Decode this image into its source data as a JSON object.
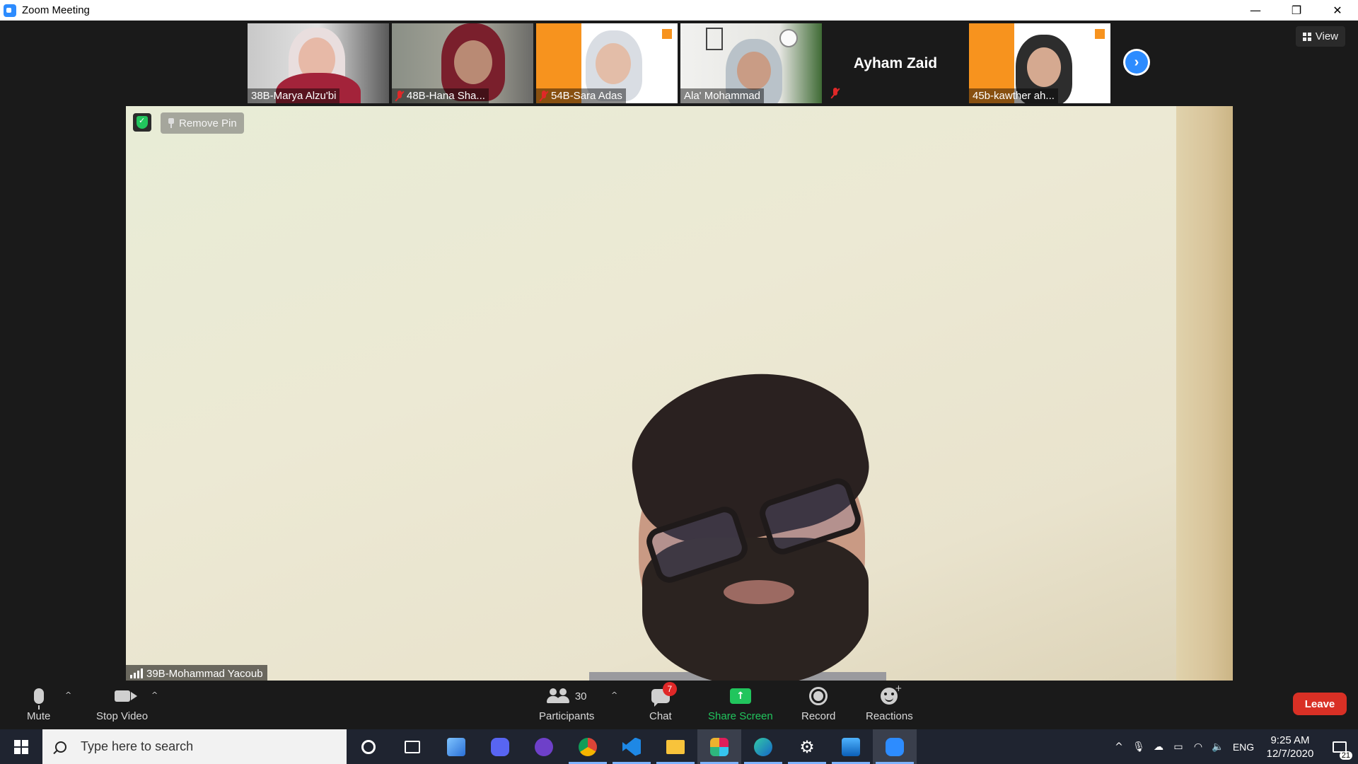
{
  "window": {
    "title": "Zoom Meeting",
    "controls": {
      "minimize": "—",
      "restore": "❐",
      "close": "✕"
    }
  },
  "thumbnails": [
    {
      "name": "38B-Marya Alzu'bi",
      "muted": false
    },
    {
      "name": "48B-Hana Sha...",
      "muted": true
    },
    {
      "name": "54B-Sara Adas",
      "muted": true
    },
    {
      "name": "Ala' Mohammad",
      "muted": false
    },
    {
      "name": "Ayham Zaid",
      "muted": true,
      "video": false
    },
    {
      "name": "45b-kawther ah...",
      "muted": false
    }
  ],
  "view_button": {
    "label": "View"
  },
  "main_video": {
    "remove_pin_label": "Remove Pin",
    "speaker_name": "39B-Mohammad Yacoub"
  },
  "toolbar": {
    "mute_label": "Mute",
    "stop_video_label": "Stop Video",
    "participants_label": "Participants",
    "participants_count": "30",
    "chat_label": "Chat",
    "chat_badge": "7",
    "share_screen_label": "Share Screen",
    "record_label": "Record",
    "reactions_label": "Reactions",
    "leave_label": "Leave"
  },
  "taskbar": {
    "search_placeholder": "Type here to search",
    "language": "ENG",
    "time": "9:25 AM",
    "date": "12/7/2020",
    "notification_count": "21",
    "apps": [
      "cortana-icon",
      "task-view-icon",
      "azure-storage-icon",
      "discord-icon",
      "github-desktop-icon",
      "chrome-icon",
      "vscode-icon",
      "file-explorer-icon",
      "slack-icon",
      "edge-icon",
      "settings-icon",
      "photos-icon",
      "zoom-icon"
    ]
  },
  "colors": {
    "zoom_blue": "#2d8cff",
    "share_green": "#21c55d",
    "leave_red": "#d93025",
    "muted_red": "#e02828"
  }
}
